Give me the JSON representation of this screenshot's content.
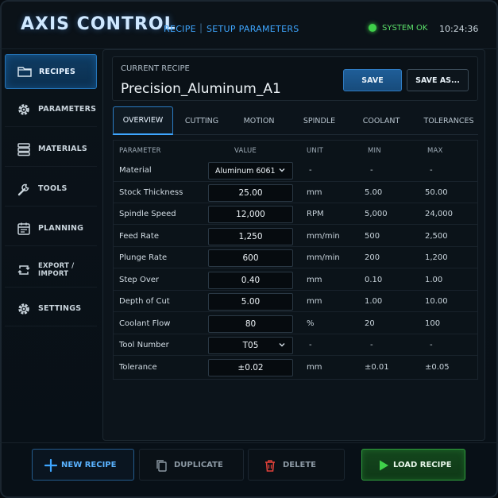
{
  "header": {
    "app_title": "AXIS CONTROL",
    "breadcrumb": [
      "RECIPE",
      "SETUP PARAMETERS"
    ],
    "status": {
      "text": "SYSTEM OK",
      "color": "#3fd04a"
    },
    "clock": "10:24:36"
  },
  "sidebar": {
    "items": [
      {
        "label": "RECIPES",
        "icon": "folder-icon",
        "active": true
      },
      {
        "label": "PARAMETERS",
        "icon": "gear-icon"
      },
      {
        "label": "MATERIALS",
        "icon": "layers-icon"
      },
      {
        "label": "TOOLS",
        "icon": "wrench-icon"
      },
      {
        "label": "PLANNING",
        "icon": "calendar-icon"
      },
      {
        "label": "EXPORT / IMPORT",
        "icon": "sync-icon"
      },
      {
        "label": "SETTINGS",
        "icon": "gear-icon"
      }
    ]
  },
  "recipe": {
    "caption": "CURRENT RECIPE",
    "name": "Precision_Aluminum_A1",
    "save_label": "SAVE",
    "save_as_label": "SAVE AS..."
  },
  "tabs": [
    "OVERVIEW",
    "CUTTING",
    "MOTION",
    "SPINDLE",
    "COOLANT",
    "TOLERANCES"
  ],
  "active_tab": "OVERVIEW",
  "table": {
    "headers": {
      "param": "PARAMETER",
      "value": "VALUE",
      "unit": "UNIT",
      "min": "MIN",
      "max": "MAX"
    },
    "rows": [
      {
        "param": "Material",
        "value": "Aluminum 6061",
        "unit": "-",
        "min": "-",
        "max": "-"
      },
      {
        "param": "Stock Thickness",
        "value": "25.00",
        "unit": "mm",
        "min": "5.00",
        "max": "50.00"
      },
      {
        "param": "Spindle Speed",
        "value": "12,000",
        "unit": "RPM",
        "min": "5,000",
        "max": "24,000"
      },
      {
        "param": "Feed Rate",
        "value": "1,250",
        "unit": "mm/min",
        "min": "500",
        "max": "2,500"
      },
      {
        "param": "Plunge Rate",
        "value": "600",
        "unit": "mm/min",
        "min": "200",
        "max": "1,200"
      },
      {
        "param": "Step Over",
        "value": "0.40",
        "unit": "mm",
        "min": "0.10",
        "max": "1.00"
      },
      {
        "param": "Depth of Cut",
        "value": "5.00",
        "unit": "mm",
        "min": "1.00",
        "max": "10.00"
      },
      {
        "param": "Coolant Flow",
        "value": "80",
        "unit": "%",
        "min": "20",
        "max": "100"
      },
      {
        "param": "Tool Number",
        "value": "T05",
        "unit": "-",
        "min": "-",
        "max": "-"
      },
      {
        "param": "Tolerance",
        "value": "±0.02",
        "unit": "mm",
        "min": "±0.01",
        "max": "±0.05"
      }
    ]
  },
  "actions": {
    "new_recipe": "NEW RECIPE",
    "duplicate": "DUPLICATE",
    "delete": "DELETE",
    "load_recipe": "LOAD RECIPE"
  },
  "colors": {
    "accent": "#3ea6ff",
    "success": "#3fd04a",
    "danger": "#e0413a",
    "background": "#070c11"
  }
}
